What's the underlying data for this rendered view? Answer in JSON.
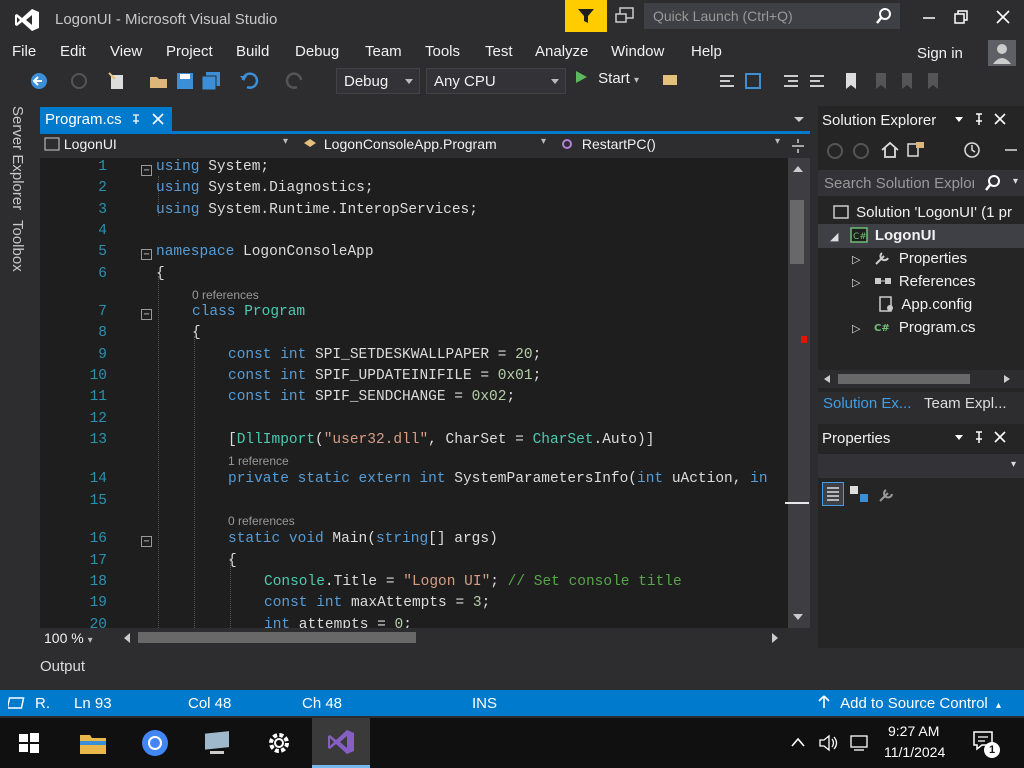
{
  "window": {
    "title": "LogonUI - Microsoft Visual Studio",
    "quick_launch_placeholder": "Quick Launch (Ctrl+Q)"
  },
  "menu": [
    "File",
    "Edit",
    "View",
    "Project",
    "Build",
    "Debug",
    "Team",
    "Tools",
    "Test",
    "Analyze",
    "Window",
    "Help"
  ],
  "sign_in": "Sign in",
  "toolbar": {
    "config": "Debug",
    "platform": "Any CPU",
    "start": "Start"
  },
  "side_tabs": [
    "Server Explorer",
    "Toolbox"
  ],
  "editor": {
    "tab": "Program.cs",
    "nav": {
      "project": "LogonUI",
      "type": "LogonConsoleApp.Program",
      "member": "RestartPC()"
    },
    "lens": {
      "class": "0 references",
      "dllimport": "1 reference",
      "main": "0 references"
    },
    "zoom": "100 %",
    "line_numbers": [
      "1",
      "2",
      "3",
      "4",
      "5",
      "6",
      "7",
      "8",
      "9",
      "10",
      "11",
      "12",
      "13",
      "14",
      "15",
      "16",
      "17",
      "18",
      "19",
      "20"
    ]
  },
  "output_label": "Output",
  "solution_explorer": {
    "title": "Solution Explorer",
    "search_placeholder": "Search Solution Explor",
    "items": [
      "Solution 'LogonUI' (1 pr",
      "LogonUI",
      "Properties",
      "References",
      "App.config",
      "Program.cs"
    ],
    "tabs": [
      "Solution Ex...",
      "Team Expl..."
    ]
  },
  "properties": {
    "title": "Properties"
  },
  "status": {
    "ready": "R.",
    "ln": "Ln 93",
    "col": "Col 48",
    "ch": "Ch 48",
    "mode": "INS",
    "source_control": "Add to Source Control"
  },
  "clock": {
    "time": "9:27 AM",
    "date": "11/1/2024",
    "notifications": "1"
  },
  "colors": {
    "accent": "#007acc",
    "keyword": "#569cd6",
    "type": "#4ec9b0",
    "string": "#d69d85",
    "comment": "#57a64a"
  }
}
